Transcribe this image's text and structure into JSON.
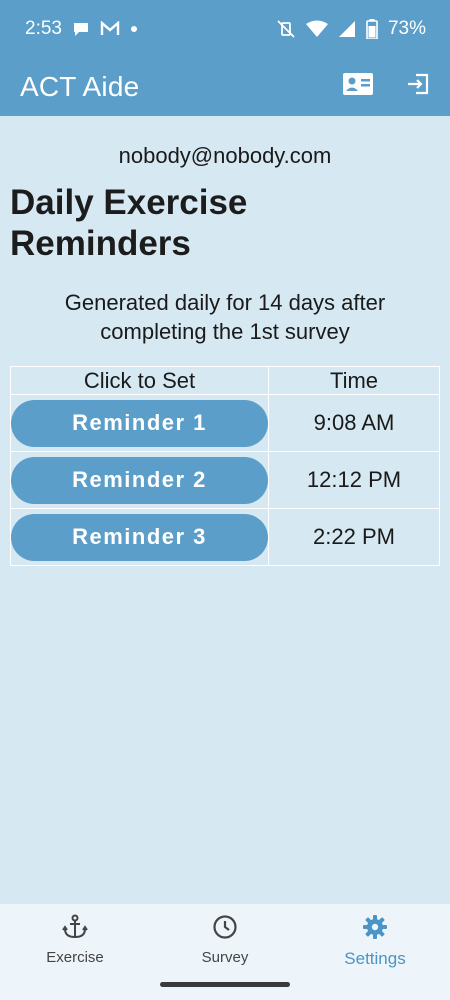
{
  "status_bar": {
    "time": "2:53",
    "battery": "73%"
  },
  "app_bar": {
    "title": "ACT Aide"
  },
  "account": {
    "email": "nobody@nobody.com"
  },
  "page": {
    "title": "Daily Exercise Reminders",
    "subtitle": "Generated daily for 14 days after completing the 1st survey"
  },
  "table": {
    "headers": [
      "Click to Set",
      "Time"
    ],
    "rows": [
      {
        "label": "Reminder 1",
        "time": "9:08 AM"
      },
      {
        "label": "Reminder 2",
        "time": "12:12 PM"
      },
      {
        "label": "Reminder 3",
        "time": "2:22 PM"
      }
    ]
  },
  "bottom_nav": {
    "items": [
      {
        "label": "Exercise",
        "icon": "anchor-icon",
        "active": false
      },
      {
        "label": "Survey",
        "icon": "clock-icon",
        "active": false
      },
      {
        "label": "Settings",
        "icon": "gear-icon",
        "active": true
      }
    ]
  },
  "colors": {
    "primary": "#5b9ec9",
    "background": "#d6e8f2",
    "nav_background": "#eef5fa",
    "active_nav": "#4a94c6"
  }
}
